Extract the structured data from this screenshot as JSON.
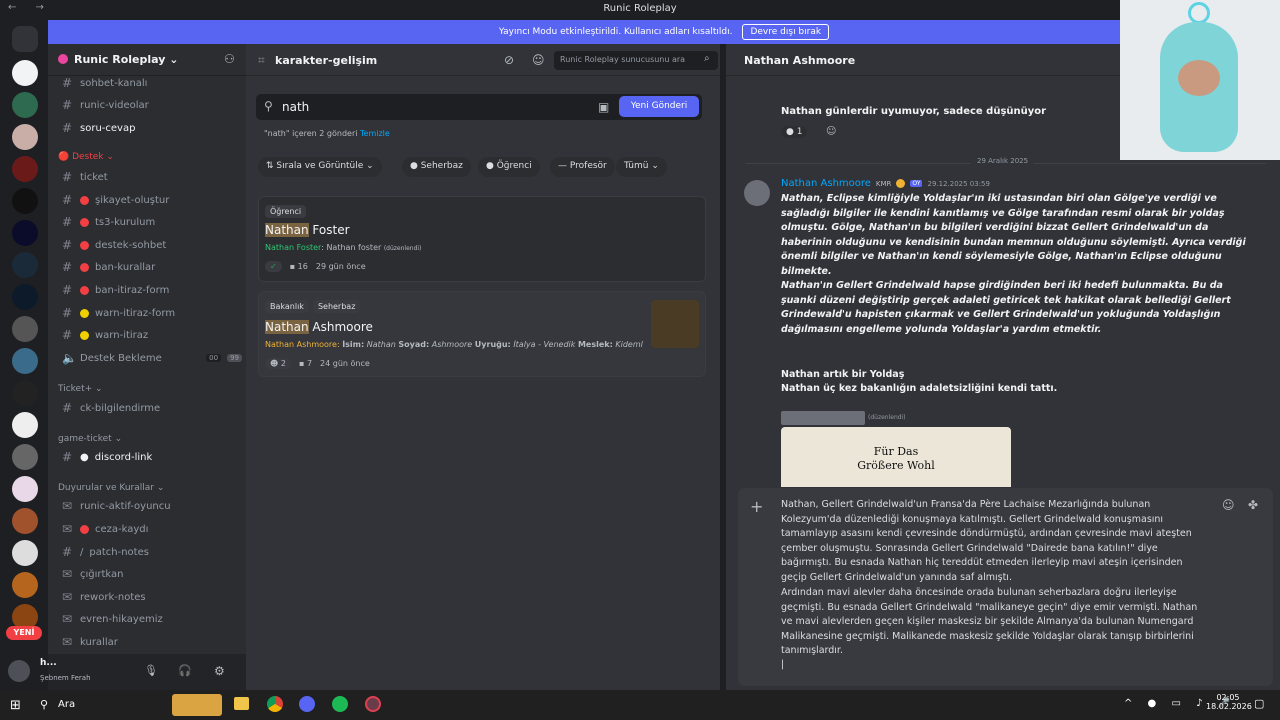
{
  "window_title": "Runic Roleplay",
  "banner": {
    "text": "Yayıncı Modu etkinleştirildi. Kullanıcı adları kısaltıldı.",
    "button": "Devre dışı bırak"
  },
  "server": {
    "name": "Runic Roleplay"
  },
  "channels": [
    {
      "name": "sohbet-kanalı",
      "type": "hash"
    },
    {
      "name": "runic-videolar",
      "type": "hash"
    },
    {
      "name": "soru-cevap",
      "type": "hash",
      "active": true
    }
  ],
  "cat_destek": "Destek",
  "destek_channels": [
    {
      "name": "ticket",
      "icon": "hash"
    },
    {
      "name": "şikayet-oluştur",
      "color": "#f23f43"
    },
    {
      "name": "ts3-kurulum",
      "color": "#f23f43"
    },
    {
      "name": "destek-sohbet",
      "color": "#f23f43"
    },
    {
      "name": "ban-kurallar",
      "color": "#f23f43"
    },
    {
      "name": "ban-itiraz-form",
      "color": "#f23f43"
    },
    {
      "name": "warn-itiraz-form",
      "color": "#f0d000"
    },
    {
      "name": "warn-itiraz",
      "color": "#f0d000"
    }
  ],
  "destek_bekleme": {
    "name": "Destek Bekleme",
    "c1": "00",
    "c2": "99"
  },
  "cat_ticket": "Ticket+",
  "ticket_channel": "ck-bilgilendirme",
  "cat_game": "game-ticket",
  "game_channel": "discord-link",
  "cat_duyuru": "Duyurular ve Kurallar",
  "duyuru_channels": [
    "runic-aktif-oyuncu",
    "ceza-kaydı",
    "patch-notes",
    "çığırtkan",
    "rework-notes",
    "evren-hikayemiz",
    "kurallar"
  ],
  "user": {
    "name": "h...",
    "status": "Şebnem Ferah"
  },
  "new_badge": "YENİ",
  "forum": {
    "channel": "karakter-gelişim",
    "search_placeholder": "Runic Roleplay sunucusunu ara",
    "query": "nath",
    "new_post": "Yeni Gönderi",
    "result_count": "\"nath\" içeren 2 gönderi",
    "clear": "Temizle"
  },
  "filters": {
    "sort": "Sırala ve Görüntüle",
    "tags": [
      "Seherbaz",
      "Öğrenci",
      "Profesör"
    ],
    "all": "Tümü"
  },
  "post1": {
    "tag": "Öğrenci",
    "title_hl": "Nathan",
    "title_rest": " Foster",
    "author": "Nathan Foster",
    "snippet": ": Nathan foster",
    "edited": "(düzenlendi)",
    "comments": "16",
    "time": "29 gün önce"
  },
  "post2": {
    "tags": [
      "Bakanlık",
      "Seherbaz"
    ],
    "title_hl": "Nathan",
    "title_rest": " Ashmoore",
    "author": "Nathan Ashmoore:",
    "snippet_a": "İsim:",
    "snippet_b": "Nathan",
    "snippet_c": "Soyad:",
    "snippet_d": "Ashmoore",
    "snippet_e": "Uyruğu:",
    "snippet_f": "İtalya - Venedik",
    "snippet_g": "Meslek:",
    "snippet_h": "Kidemli...",
    "reacts": "2",
    "comments": "7",
    "time": "24 gün önce"
  },
  "thread": {
    "title": "Nathan Ashmoore",
    "top_msg": "Nathan günlerdir uyumuyor, sadece düşünüyor",
    "react_count": "1",
    "date_divider": "29 Aralık 2025",
    "author": "Nathan Ashmoore",
    "badge": "KMR",
    "badge2": "OY",
    "timestamp": "29.12.2025 03:59",
    "p1": "Nathan, Eclipse kimliğiyle Yoldaşlar'ın iki ustasından biri olan Gölge'ye verdiği ve sağladığı bilgiler ile kendini kanıtlamış ve Gölge tarafından resmi olarak bir yoldaş olmuştu. Gölge, Nathan'ın bu bilgileri verdiğini bizzat Gellert Grindelwald'un da haberinin olduğunu ve kendisinin bundan memnun olduğunu söylemişti. Ayrıca verdiği önemli bilgiler ve Nathan'ın kendi söylemesiyle Gölge, Nathan'ın Eclipse olduğunu bilmekte.",
    "p2": "Nathan'ın Gellert Grindelwald hapse girdiğinden beri iki hedefi bulunmakta. Bu da şuanki düzeni değiştirip gerçek adaleti getiricek tek hakikat olarak bellediği Gellert Grindewald'u hapisten çıkarmak ve Gellert Grindelwald'un yokluğunda Yoldaşlığın dağılmasını engelleme yolunda Yoldaşlar'a yardım etmektir.",
    "p3": "Nathan artık bir Yoldaş",
    "p4": "Nathan üç kez bakanlığın adaletsizliğini kendi tattı.",
    "edited": "(düzenlendi)",
    "img_text1": "Für Das",
    "img_text2": "Größere Wohl"
  },
  "draft": {
    "p1": "Nathan, Gellert Grindelwald'un Fransa'da Père Lachaise Mezarlığında bulunan Kolezyum'da düzenlediği konuşmaya katılmıştı. Gellert Grindelwald konuşmasını tamamlayıp asasını kendi çevresinde döndürmüştü, ardından çevresinde mavi ateşten çember oluşmuştu. Sonrasında Gellert Grindelwald \"Dairede bana katılın!\" diye bağırmıştı. Bu esnada Nathan hiç tereddüt etmeden ilerleyip mavi ateşin içerisinden geçip Gellert Grindelwald'un yanında saf almıştı.",
    "p2": "Ardından mavi alevler daha öncesinde orada bulunan seherbazlara doğru ilerleyişe geçmişti. Bu esnada Gellert Grindelwald \"malikaneye geçin\" diye emir vermişti. Nathan ve mavi alevlerden geçen kişiler maskesiz bir şekilde Almanya'da bulunan Numengard Malikanesine geçmişti. Malikanede maskesiz şekilde Yoldaşlar olarak tanışıp birbirlerini tanımışlardır.",
    "cursor": "|"
  },
  "taskbar": {
    "search": "Ara",
    "time": "02:05",
    "date": "18.02.2026"
  }
}
